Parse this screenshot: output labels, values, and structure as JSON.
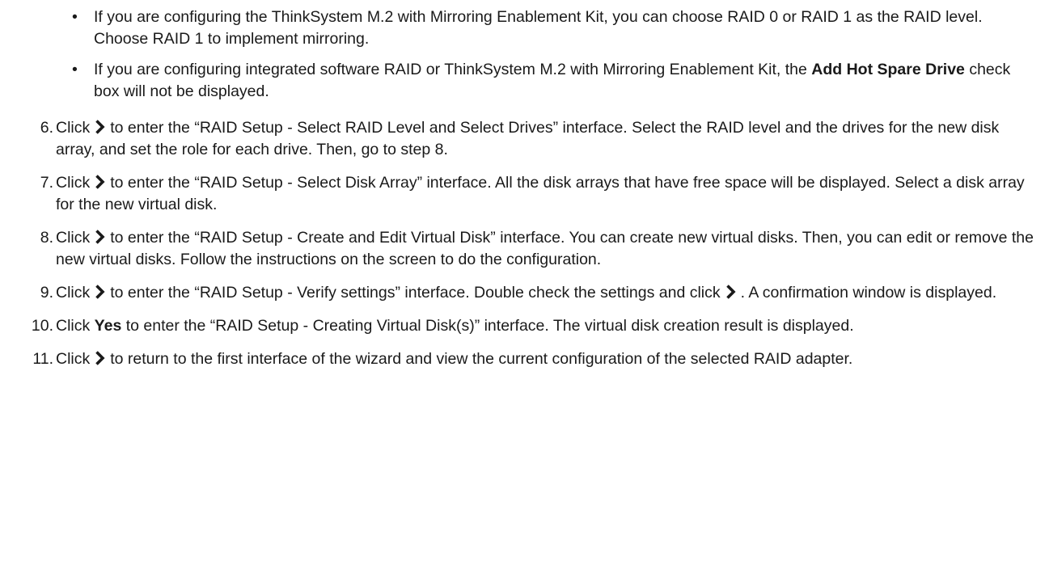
{
  "bullets": [
    {
      "marker": "•",
      "text": "If you are configuring the ThinkSystem M.2 with Mirroring Enablement Kit, you can choose RAID 0 or RAID 1 as the RAID level. Choose RAID 1 to implement mirroring."
    },
    {
      "marker": "•",
      "pre": "If you are configuring integrated software RAID or ThinkSystem M.2 with Mirroring Enablement Kit, the ",
      "bold": "Add Hot Spare Drive",
      "post": " check box will not be displayed."
    }
  ],
  "steps": [
    {
      "num": "6.",
      "before": "Click",
      "after": "to enter the “RAID Setup - Select RAID Level and Select Drives” interface. Select the RAID level and the drives for the new disk array, and set the role for each drive. Then, go to step 8."
    },
    {
      "num": "7.",
      "before": "Click",
      "after": "to enter the “RAID Setup - Select Disk Array” interface. All the disk arrays that have free space will be displayed. Select a disk array for the new virtual disk."
    },
    {
      "num": "8.",
      "before": "Click",
      "after": "to enter the “RAID Setup - Create and Edit Virtual Disk” interface. You can create new virtual disks. Then, you can edit or remove the new virtual disks. Follow the instructions on the screen to do the configuration."
    },
    {
      "num": "9.",
      "before": "Click",
      "middle": "to enter the “RAID Setup - Verify settings” interface. Double check the settings and click",
      "after": ". A confirmation window is displayed."
    },
    {
      "num": "10.",
      "before": "Click",
      "bold": "Yes",
      "after": "to enter the “RAID Setup - Creating Virtual Disk(s)” interface. The virtual disk creation result is displayed."
    },
    {
      "num": "11.",
      "before": "Click",
      "after": "to return to the first interface of the wizard and view the current configuration of the selected RAID adapter."
    }
  ],
  "icons": {
    "next": "chevron-right-icon"
  },
  "colors": {
    "text": "#1a1a1a",
    "icon": "#1a1a1a"
  }
}
